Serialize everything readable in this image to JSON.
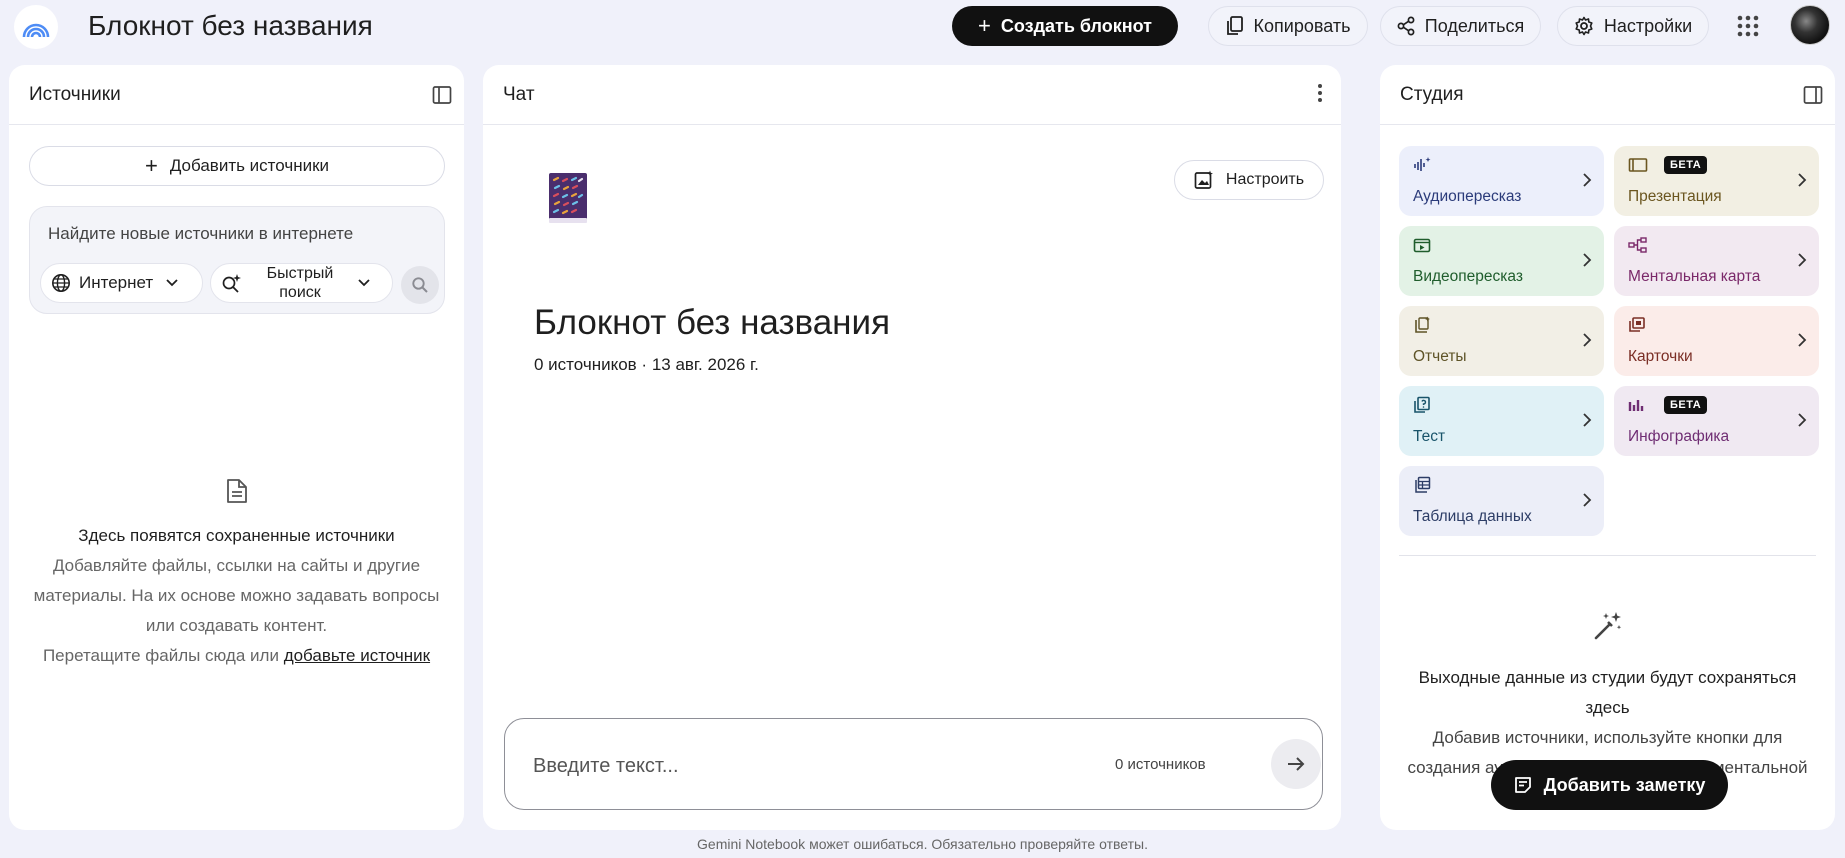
{
  "header": {
    "title": "Блокнот без названия",
    "create_label": "Создать блокнот",
    "copy_label": "Копировать",
    "share_label": "Поделиться",
    "settings_label": "Настройки"
  },
  "sources": {
    "title": "Источники",
    "add_label": "Добавить источники",
    "search_placeholder": "Найдите новые источники в интернете",
    "internet_label": "Интернет",
    "fast_search_label": "Быстрый поиск",
    "empty_title": "Здесь появятся сохраненные источники",
    "empty_desc": "Добавляйте файлы, ссылки на сайты и другие материалы. На их основе можно задавать вопросы или создавать контент.",
    "drag_text": "Перетащите файлы сюда или",
    "drag_link": "добавьте источник"
  },
  "chat": {
    "title": "Чат",
    "customize_label": "Настроить",
    "notebook_title": "Блокнот без названия",
    "notebook_meta": "0 источников · 13 авг. 2026 г.",
    "input_placeholder": "Введите текст...",
    "source_count": "0 источников"
  },
  "studio": {
    "title": "Студия",
    "beta_label": "БЕТА",
    "tiles": [
      {
        "label": "Аудиопересказ",
        "icon": "audio-icon"
      },
      {
        "label": "Презентация",
        "icon": "presentation-icon",
        "beta": true
      },
      {
        "label": "Видеопересказ",
        "icon": "video-icon"
      },
      {
        "label": "Ментальная карта",
        "icon": "mindmap-icon"
      },
      {
        "label": "Отчеты",
        "icon": "report-icon"
      },
      {
        "label": "Карточки",
        "icon": "cards-icon"
      },
      {
        "label": "Тест",
        "icon": "quiz-icon"
      },
      {
        "label": "Инфографика",
        "icon": "infographic-icon",
        "beta": true
      },
      {
        "label": "Таблица данных",
        "icon": "table-icon"
      }
    ],
    "empty_title": "Выходные данные из студии будут сохраняться здесь",
    "empty_desc": "Добавив источники, используйте кнопки для создания аудиопересказа, методички, ментальной",
    "add_note_label": "Добавить заметку"
  },
  "footer": {
    "disclaimer": "Gemini Notebook может ошибаться. Обязательно проверяйте ответы."
  }
}
